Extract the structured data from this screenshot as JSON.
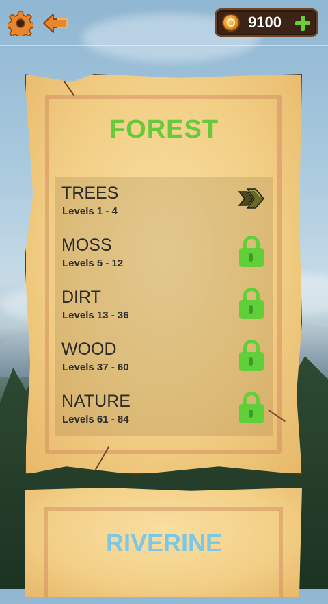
{
  "header": {
    "coins": "9100"
  },
  "section_current": {
    "title": "FOREST",
    "title_color": "#67c93c",
    "levels": [
      {
        "name": "TREES",
        "range": "Levels 1 - 4",
        "status": "unlocked",
        "icon": "play-arrows-icon"
      },
      {
        "name": "MOSS",
        "range": "Levels 5 - 12",
        "status": "locked",
        "icon": "lock-icon"
      },
      {
        "name": "DIRT",
        "range": "Levels 13 - 36",
        "status": "locked",
        "icon": "lock-icon"
      },
      {
        "name": "WOOD",
        "range": "Levels 37 - 60",
        "status": "locked",
        "icon": "lock-icon"
      },
      {
        "name": "NATURE",
        "range": "Levels 61 - 84",
        "status": "locked",
        "icon": "lock-icon"
      }
    ]
  },
  "section_next": {
    "title": "RIVERINE",
    "title_color": "#7cc6e6"
  },
  "colors": {
    "lock_green": "#5fcf3a",
    "accent_orange": "#e9862b"
  }
}
